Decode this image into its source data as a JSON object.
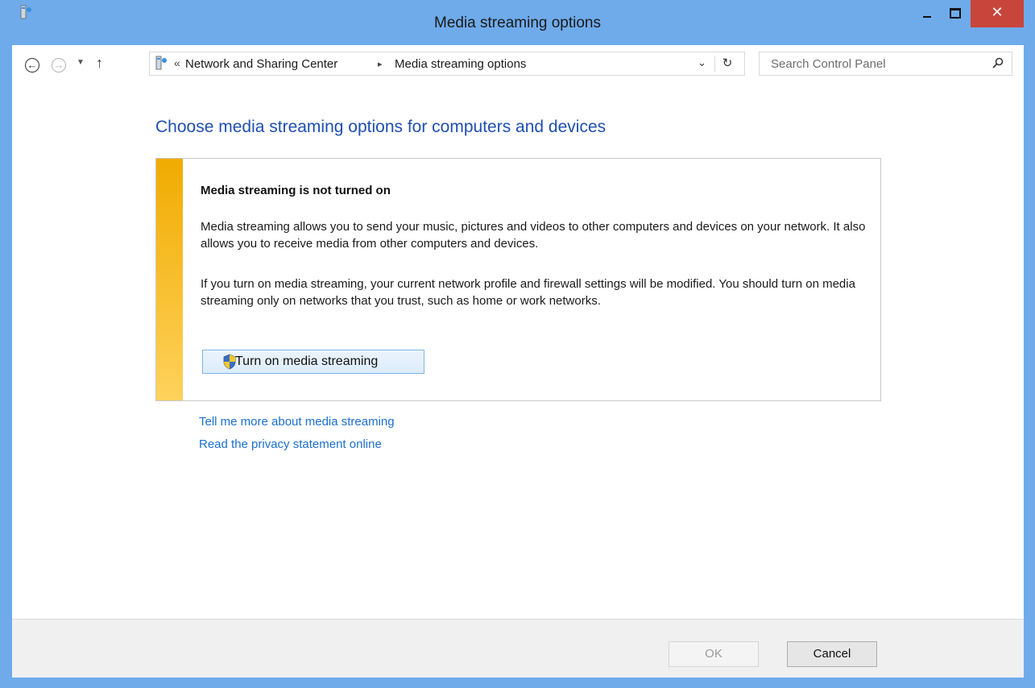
{
  "window": {
    "title": "Media streaming options",
    "close_glyph": "✕"
  },
  "nav": {
    "back_glyph": "←",
    "forward_glyph": "→",
    "recent_glyph": "▼",
    "up_glyph": "↑",
    "breadcrumb_prefix": "«",
    "breadcrumb": [
      "Network and Sharing Center",
      "Media streaming options"
    ],
    "breadcrumb_sep": "▸",
    "dropdown_glyph": "⌄",
    "refresh_glyph": "↻",
    "search_placeholder": "Search Control Panel"
  },
  "main": {
    "title": "Choose media streaming options for computers and devices",
    "panel": {
      "heading": "Media streaming is not turned on",
      "paragraph1": "Media streaming allows you to send your music, pictures and videos to other computers and devices on your network.  It also allows you to receive media from other computers and devices.",
      "paragraph2": "If you turn on media streaming, your current network profile and firewall settings will be modified. You should turn on media streaming only on networks that you trust, such as home or work networks.",
      "button_label": "Turn on media streaming"
    },
    "links": [
      "Tell me more about media streaming",
      "Read the privacy statement online"
    ]
  },
  "footer": {
    "ok_label": "OK",
    "ok_enabled": false,
    "cancel_label": "Cancel"
  },
  "colors": {
    "title_bar": "#6fabeb",
    "close_button": "#c7453a",
    "heading_blue": "#1f4fb0",
    "link_blue": "#1a6fce",
    "warning_stripe_top": "#f0ab00",
    "warning_stripe_bottom": "#ffd25c"
  }
}
